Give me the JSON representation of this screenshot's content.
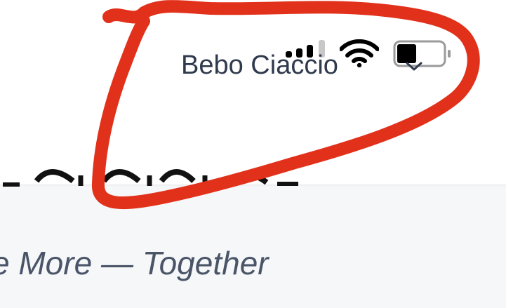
{
  "header": {
    "user_name": "Bebo Ciaccio",
    "icons": [
      "chevron-down-icon"
    ]
  },
  "status_bar": {
    "icons": [
      "signal-icon",
      "wifi-icon",
      "battery-icon"
    ]
  },
  "main": {
    "title": "",
    "subtitle": "e More — Together"
  },
  "colors": {
    "annotation_red": "#e2311b",
    "text_dark": "#2f3a4d",
    "subtitle": "#4a5568",
    "page_background": "#f6f7f9"
  }
}
